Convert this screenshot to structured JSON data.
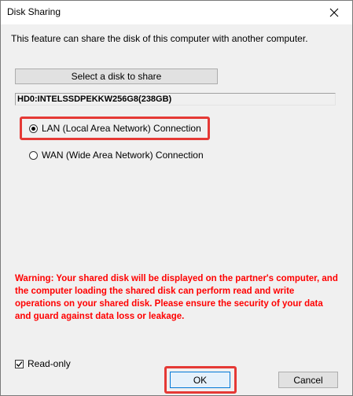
{
  "window": {
    "title": "Disk Sharing",
    "close_icon": "close-icon"
  },
  "main": {
    "description": "This feature can share the disk of this computer with another computer.",
    "select_disk_label": "Select a disk to share",
    "selected_disk": "HD0:INTELSSDPEKKW256G8(238GB)",
    "connection_options": [
      {
        "label": "LAN (Local Area Network) Connection",
        "selected": true
      },
      {
        "label": "WAN (Wide Area Network) Connection",
        "selected": false
      }
    ],
    "warning": "Warning: Your shared disk will be displayed on the partner's computer, and the computer loading the shared disk can perform read and write operations on your shared disk. Please ensure the security of your data and guard against data loss or leakage.",
    "warning_color": "#ff0000",
    "highlight_color": "#e53935"
  },
  "footer": {
    "read_only_label": "Read-only",
    "read_only_checked": true,
    "ok_label": "OK",
    "cancel_label": "Cancel"
  }
}
